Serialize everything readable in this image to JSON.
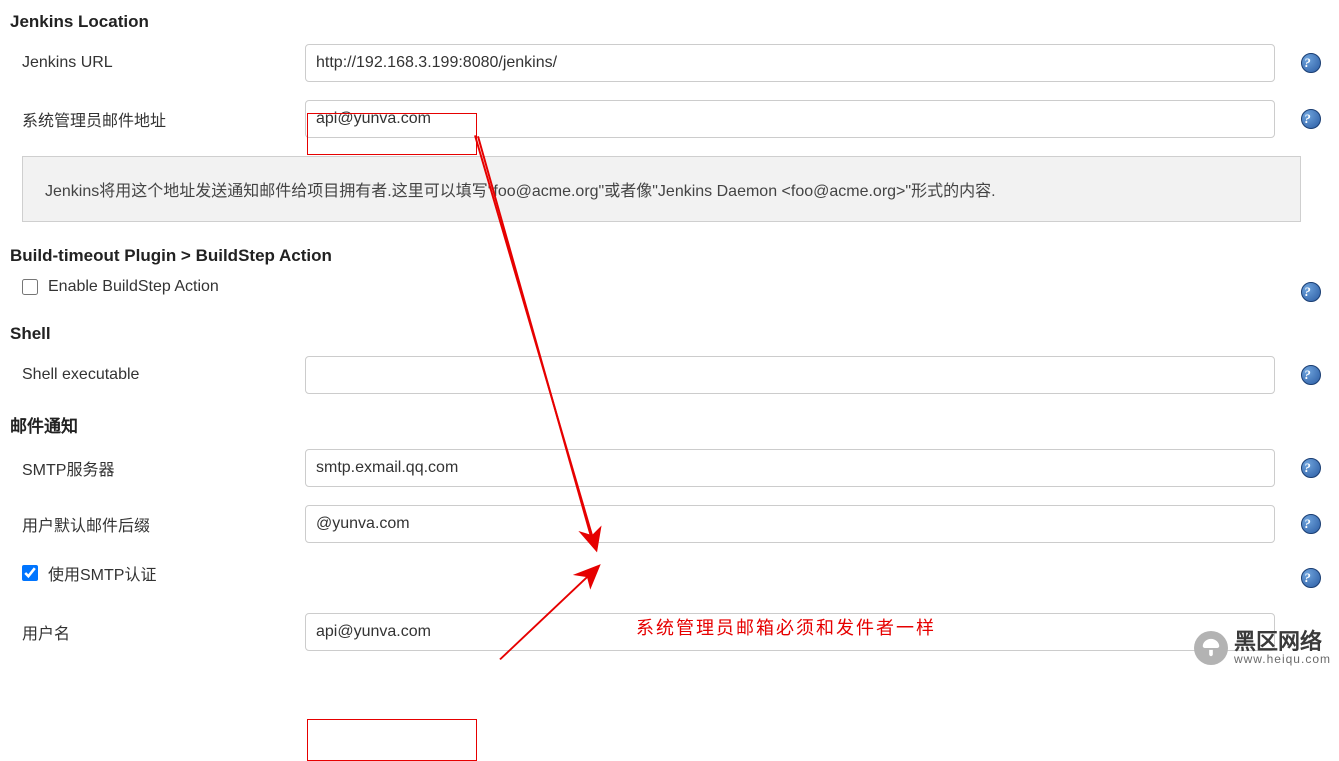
{
  "sections": {
    "jenkins_location": {
      "title": "Jenkins Location",
      "url_label": "Jenkins URL",
      "url_value": "http://192.168.3.199:8080/jenkins/",
      "admin_email_label": "系统管理员邮件地址",
      "admin_email_value": "api@yunva.com",
      "description": "Jenkins将用这个地址发送通知邮件给项目拥有者.这里可以填写\"foo@acme.org\"或者像\"Jenkins Daemon <foo@acme.org>\"形式的内容."
    },
    "build_timeout": {
      "title": "Build-timeout Plugin > BuildStep Action",
      "enable_label": "Enable BuildStep Action",
      "enable_checked": false
    },
    "shell": {
      "title": "Shell",
      "exec_label": "Shell executable",
      "exec_value": ""
    },
    "mail": {
      "title": "邮件通知",
      "smtp_label": "SMTP服务器",
      "smtp_value": "smtp.exmail.qq.com",
      "suffix_label": "用户默认邮件后缀",
      "suffix_value": "@yunva.com",
      "auth_label": "使用SMTP认证",
      "auth_checked": true,
      "username_label": "用户名",
      "username_value": "api@yunva.com"
    }
  },
  "annotation": {
    "text": "系统管理员邮箱必须和发件者一样"
  },
  "watermark": {
    "main": "黑区网络",
    "sub": "www.heiqu.com"
  },
  "help_glyph": "?"
}
